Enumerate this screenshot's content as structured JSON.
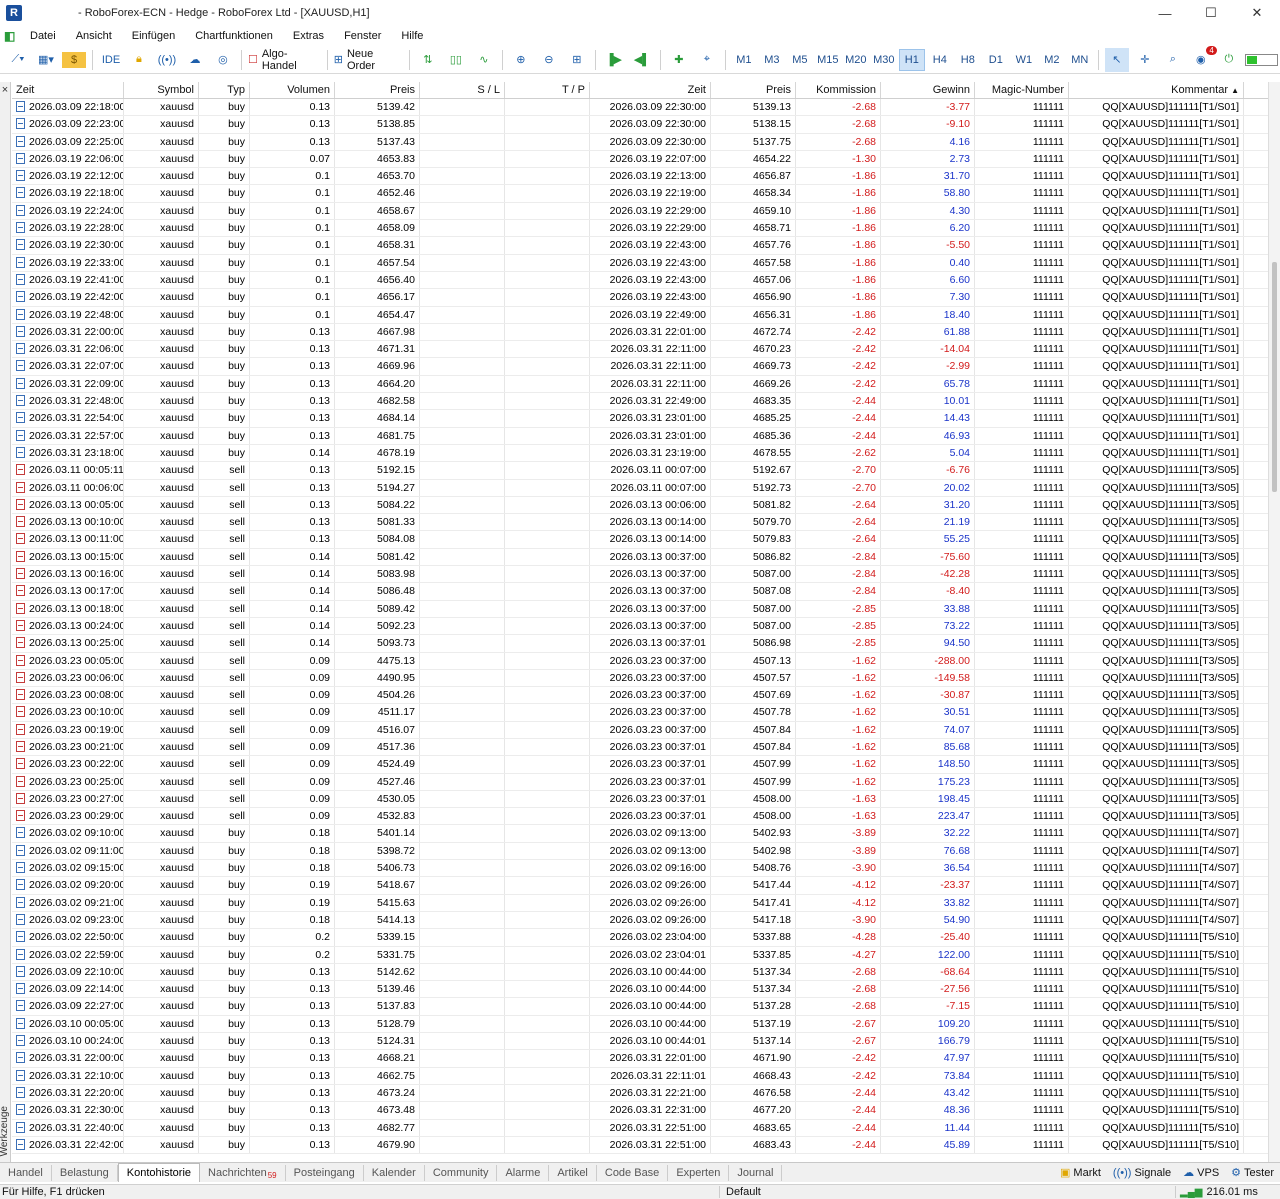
{
  "window": {
    "title": "- RoboForex-ECN - Hedge - RoboForex Ltd - [XAUUSD,H1]",
    "app_icon": "R"
  },
  "menu": [
    "Datei",
    "Ansicht",
    "Einfügen",
    "Chartfunktionen",
    "Extras",
    "Fenster",
    "Hilfe"
  ],
  "toolbar": {
    "ide_label": "IDE",
    "algo_label": "Algo-Handel",
    "order_label": "Neue Order",
    "timeframes": [
      "M1",
      "M3",
      "M5",
      "M15",
      "M20",
      "M30",
      "H1",
      "H4",
      "H8",
      "D1",
      "W1",
      "M2",
      "MN"
    ],
    "active_timeframe": "H1",
    "alert_count": "4"
  },
  "table": {
    "headers": [
      "Zeit",
      "Symbol",
      "Typ",
      "Volumen",
      "Preis",
      "S / L",
      "T / P",
      "Zeit",
      "Preis",
      "Kommission",
      "Gewinn",
      "Magic-Number",
      "Kommentar"
    ],
    "sort_arrow": "▲",
    "rows": [
      [
        "2026.03.09 22:18:00",
        "xauusd",
        "buy",
        "0.13",
        "5139.42",
        "",
        "",
        "2026.03.09 22:30:00",
        "5139.13",
        "-2.68",
        "-3.77",
        "111111",
        "QQ[XAUUSD]111111[T1/S01]"
      ],
      [
        "2026.03.09 22:23:00",
        "xauusd",
        "buy",
        "0.13",
        "5138.85",
        "",
        "",
        "2026.03.09 22:30:00",
        "5138.15",
        "-2.68",
        "-9.10",
        "111111",
        "QQ[XAUUSD]111111[T1/S01]"
      ],
      [
        "2026.03.09 22:25:00",
        "xauusd",
        "buy",
        "0.13",
        "5137.43",
        "",
        "",
        "2026.03.09 22:30:00",
        "5137.75",
        "-2.68",
        "4.16",
        "111111",
        "QQ[XAUUSD]111111[T1/S01]"
      ],
      [
        "2026.03.19 22:06:00",
        "xauusd",
        "buy",
        "0.07",
        "4653.83",
        "",
        "",
        "2026.03.19 22:07:00",
        "4654.22",
        "-1.30",
        "2.73",
        "111111",
        "QQ[XAUUSD]111111[T1/S01]"
      ],
      [
        "2026.03.19 22:12:00",
        "xauusd",
        "buy",
        "0.1",
        "4653.70",
        "",
        "",
        "2026.03.19 22:13:00",
        "4656.87",
        "-1.86",
        "31.70",
        "111111",
        "QQ[XAUUSD]111111[T1/S01]"
      ],
      [
        "2026.03.19 22:18:00",
        "xauusd",
        "buy",
        "0.1",
        "4652.46",
        "",
        "",
        "2026.03.19 22:19:00",
        "4658.34",
        "-1.86",
        "58.80",
        "111111",
        "QQ[XAUUSD]111111[T1/S01]"
      ],
      [
        "2026.03.19 22:24:00",
        "xauusd",
        "buy",
        "0.1",
        "4658.67",
        "",
        "",
        "2026.03.19 22:29:00",
        "4659.10",
        "-1.86",
        "4.30",
        "111111",
        "QQ[XAUUSD]111111[T1/S01]"
      ],
      [
        "2026.03.19 22:28:00",
        "xauusd",
        "buy",
        "0.1",
        "4658.09",
        "",
        "",
        "2026.03.19 22:29:00",
        "4658.71",
        "-1.86",
        "6.20",
        "111111",
        "QQ[XAUUSD]111111[T1/S01]"
      ],
      [
        "2026.03.19 22:30:00",
        "xauusd",
        "buy",
        "0.1",
        "4658.31",
        "",
        "",
        "2026.03.19 22:43:00",
        "4657.76",
        "-1.86",
        "-5.50",
        "111111",
        "QQ[XAUUSD]111111[T1/S01]"
      ],
      [
        "2026.03.19 22:33:00",
        "xauusd",
        "buy",
        "0.1",
        "4657.54",
        "",
        "",
        "2026.03.19 22:43:00",
        "4657.58",
        "-1.86",
        "0.40",
        "111111",
        "QQ[XAUUSD]111111[T1/S01]"
      ],
      [
        "2026.03.19 22:41:00",
        "xauusd",
        "buy",
        "0.1",
        "4656.40",
        "",
        "",
        "2026.03.19 22:43:00",
        "4657.06",
        "-1.86",
        "6.60",
        "111111",
        "QQ[XAUUSD]111111[T1/S01]"
      ],
      [
        "2026.03.19 22:42:00",
        "xauusd",
        "buy",
        "0.1",
        "4656.17",
        "",
        "",
        "2026.03.19 22:43:00",
        "4656.90",
        "-1.86",
        "7.30",
        "111111",
        "QQ[XAUUSD]111111[T1/S01]"
      ],
      [
        "2026.03.19 22:48:00",
        "xauusd",
        "buy",
        "0.1",
        "4654.47",
        "",
        "",
        "2026.03.19 22:49:00",
        "4656.31",
        "-1.86",
        "18.40",
        "111111",
        "QQ[XAUUSD]111111[T1/S01]"
      ],
      [
        "2026.03.31 22:00:00",
        "xauusd",
        "buy",
        "0.13",
        "4667.98",
        "",
        "",
        "2026.03.31 22:01:00",
        "4672.74",
        "-2.42",
        "61.88",
        "111111",
        "QQ[XAUUSD]111111[T1/S01]"
      ],
      [
        "2026.03.31 22:06:00",
        "xauusd",
        "buy",
        "0.13",
        "4671.31",
        "",
        "",
        "2026.03.31 22:11:00",
        "4670.23",
        "-2.42",
        "-14.04",
        "111111",
        "QQ[XAUUSD]111111[T1/S01]"
      ],
      [
        "2026.03.31 22:07:00",
        "xauusd",
        "buy",
        "0.13",
        "4669.96",
        "",
        "",
        "2026.03.31 22:11:00",
        "4669.73",
        "-2.42",
        "-2.99",
        "111111",
        "QQ[XAUUSD]111111[T1/S01]"
      ],
      [
        "2026.03.31 22:09:00",
        "xauusd",
        "buy",
        "0.13",
        "4664.20",
        "",
        "",
        "2026.03.31 22:11:00",
        "4669.26",
        "-2.42",
        "65.78",
        "111111",
        "QQ[XAUUSD]111111[T1/S01]"
      ],
      [
        "2026.03.31 22:48:00",
        "xauusd",
        "buy",
        "0.13",
        "4682.58",
        "",
        "",
        "2026.03.31 22:49:00",
        "4683.35",
        "-2.44",
        "10.01",
        "111111",
        "QQ[XAUUSD]111111[T1/S01]"
      ],
      [
        "2026.03.31 22:54:00",
        "xauusd",
        "buy",
        "0.13",
        "4684.14",
        "",
        "",
        "2026.03.31 23:01:00",
        "4685.25",
        "-2.44",
        "14.43",
        "111111",
        "QQ[XAUUSD]111111[T1/S01]"
      ],
      [
        "2026.03.31 22:57:00",
        "xauusd",
        "buy",
        "0.13",
        "4681.75",
        "",
        "",
        "2026.03.31 23:01:00",
        "4685.36",
        "-2.44",
        "46.93",
        "111111",
        "QQ[XAUUSD]111111[T1/S01]"
      ],
      [
        "2026.03.31 23:18:00",
        "xauusd",
        "buy",
        "0.14",
        "4678.19",
        "",
        "",
        "2026.03.31 23:19:00",
        "4678.55",
        "-2.62",
        "5.04",
        "111111",
        "QQ[XAUUSD]111111[T1/S01]"
      ],
      [
        "2026.03.11 00:05:11",
        "xauusd",
        "sell",
        "0.13",
        "5192.15",
        "",
        "",
        "2026.03.11 00:07:00",
        "5192.67",
        "-2.70",
        "-6.76",
        "111111",
        "QQ[XAUUSD]111111[T3/S05]"
      ],
      [
        "2026.03.11 00:06:00",
        "xauusd",
        "sell",
        "0.13",
        "5194.27",
        "",
        "",
        "2026.03.11 00:07:00",
        "5192.73",
        "-2.70",
        "20.02",
        "111111",
        "QQ[XAUUSD]111111[T3/S05]"
      ],
      [
        "2026.03.13 00:05:00",
        "xauusd",
        "sell",
        "0.13",
        "5084.22",
        "",
        "",
        "2026.03.13 00:06:00",
        "5081.82",
        "-2.64",
        "31.20",
        "111111",
        "QQ[XAUUSD]111111[T3/S05]"
      ],
      [
        "2026.03.13 00:10:00",
        "xauusd",
        "sell",
        "0.13",
        "5081.33",
        "",
        "",
        "2026.03.13 00:14:00",
        "5079.70",
        "-2.64",
        "21.19",
        "111111",
        "QQ[XAUUSD]111111[T3/S05]"
      ],
      [
        "2026.03.13 00:11:00",
        "xauusd",
        "sell",
        "0.13",
        "5084.08",
        "",
        "",
        "2026.03.13 00:14:00",
        "5079.83",
        "-2.64",
        "55.25",
        "111111",
        "QQ[XAUUSD]111111[T3/S05]"
      ],
      [
        "2026.03.13 00:15:00",
        "xauusd",
        "sell",
        "0.14",
        "5081.42",
        "",
        "",
        "2026.03.13 00:37:00",
        "5086.82",
        "-2.84",
        "-75.60",
        "111111",
        "QQ[XAUUSD]111111[T3/S05]"
      ],
      [
        "2026.03.13 00:16:00",
        "xauusd",
        "sell",
        "0.14",
        "5083.98",
        "",
        "",
        "2026.03.13 00:37:00",
        "5087.00",
        "-2.84",
        "-42.28",
        "111111",
        "QQ[XAUUSD]111111[T3/S05]"
      ],
      [
        "2026.03.13 00:17:00",
        "xauusd",
        "sell",
        "0.14",
        "5086.48",
        "",
        "",
        "2026.03.13 00:37:00",
        "5087.08",
        "-2.84",
        "-8.40",
        "111111",
        "QQ[XAUUSD]111111[T3/S05]"
      ],
      [
        "2026.03.13 00:18:00",
        "xauusd",
        "sell",
        "0.14",
        "5089.42",
        "",
        "",
        "2026.03.13 00:37:00",
        "5087.00",
        "-2.85",
        "33.88",
        "111111",
        "QQ[XAUUSD]111111[T3/S05]"
      ],
      [
        "2026.03.13 00:24:00",
        "xauusd",
        "sell",
        "0.14",
        "5092.23",
        "",
        "",
        "2026.03.13 00:37:00",
        "5087.00",
        "-2.85",
        "73.22",
        "111111",
        "QQ[XAUUSD]111111[T3/S05]"
      ],
      [
        "2026.03.13 00:25:00",
        "xauusd",
        "sell",
        "0.14",
        "5093.73",
        "",
        "",
        "2026.03.13 00:37:01",
        "5086.98",
        "-2.85",
        "94.50",
        "111111",
        "QQ[XAUUSD]111111[T3/S05]"
      ],
      [
        "2026.03.23 00:05:00",
        "xauusd",
        "sell",
        "0.09",
        "4475.13",
        "",
        "",
        "2026.03.23 00:37:00",
        "4507.13",
        "-1.62",
        "-288.00",
        "111111",
        "QQ[XAUUSD]111111[T3/S05]"
      ],
      [
        "2026.03.23 00:06:00",
        "xauusd",
        "sell",
        "0.09",
        "4490.95",
        "",
        "",
        "2026.03.23 00:37:00",
        "4507.57",
        "-1.62",
        "-149.58",
        "111111",
        "QQ[XAUUSD]111111[T3/S05]"
      ],
      [
        "2026.03.23 00:08:00",
        "xauusd",
        "sell",
        "0.09",
        "4504.26",
        "",
        "",
        "2026.03.23 00:37:00",
        "4507.69",
        "-1.62",
        "-30.87",
        "111111",
        "QQ[XAUUSD]111111[T3/S05]"
      ],
      [
        "2026.03.23 00:10:00",
        "xauusd",
        "sell",
        "0.09",
        "4511.17",
        "",
        "",
        "2026.03.23 00:37:00",
        "4507.78",
        "-1.62",
        "30.51",
        "111111",
        "QQ[XAUUSD]111111[T3/S05]"
      ],
      [
        "2026.03.23 00:19:00",
        "xauusd",
        "sell",
        "0.09",
        "4516.07",
        "",
        "",
        "2026.03.23 00:37:00",
        "4507.84",
        "-1.62",
        "74.07",
        "111111",
        "QQ[XAUUSD]111111[T3/S05]"
      ],
      [
        "2026.03.23 00:21:00",
        "xauusd",
        "sell",
        "0.09",
        "4517.36",
        "",
        "",
        "2026.03.23 00:37:01",
        "4507.84",
        "-1.62",
        "85.68",
        "111111",
        "QQ[XAUUSD]111111[T3/S05]"
      ],
      [
        "2026.03.23 00:22:00",
        "xauusd",
        "sell",
        "0.09",
        "4524.49",
        "",
        "",
        "2026.03.23 00:37:01",
        "4507.99",
        "-1.62",
        "148.50",
        "111111",
        "QQ[XAUUSD]111111[T3/S05]"
      ],
      [
        "2026.03.23 00:25:00",
        "xauusd",
        "sell",
        "0.09",
        "4527.46",
        "",
        "",
        "2026.03.23 00:37:01",
        "4507.99",
        "-1.62",
        "175.23",
        "111111",
        "QQ[XAUUSD]111111[T3/S05]"
      ],
      [
        "2026.03.23 00:27:00",
        "xauusd",
        "sell",
        "0.09",
        "4530.05",
        "",
        "",
        "2026.03.23 00:37:01",
        "4508.00",
        "-1.63",
        "198.45",
        "111111",
        "QQ[XAUUSD]111111[T3/S05]"
      ],
      [
        "2026.03.23 00:29:00",
        "xauusd",
        "sell",
        "0.09",
        "4532.83",
        "",
        "",
        "2026.03.23 00:37:01",
        "4508.00",
        "-1.63",
        "223.47",
        "111111",
        "QQ[XAUUSD]111111[T3/S05]"
      ],
      [
        "2026.03.02 09:10:00",
        "xauusd",
        "buy",
        "0.18",
        "5401.14",
        "",
        "",
        "2026.03.02 09:13:00",
        "5402.93",
        "-3.89",
        "32.22",
        "111111",
        "QQ[XAUUSD]111111[T4/S07]"
      ],
      [
        "2026.03.02 09:11:00",
        "xauusd",
        "buy",
        "0.18",
        "5398.72",
        "",
        "",
        "2026.03.02 09:13:00",
        "5402.98",
        "-3.89",
        "76.68",
        "111111",
        "QQ[XAUUSD]111111[T4/S07]"
      ],
      [
        "2026.03.02 09:15:00",
        "xauusd",
        "buy",
        "0.18",
        "5406.73",
        "",
        "",
        "2026.03.02 09:16:00",
        "5408.76",
        "-3.90",
        "36.54",
        "111111",
        "QQ[XAUUSD]111111[T4/S07]"
      ],
      [
        "2026.03.02 09:20:00",
        "xauusd",
        "buy",
        "0.19",
        "5418.67",
        "",
        "",
        "2026.03.02 09:26:00",
        "5417.44",
        "-4.12",
        "-23.37",
        "111111",
        "QQ[XAUUSD]111111[T4/S07]"
      ],
      [
        "2026.03.02 09:21:00",
        "xauusd",
        "buy",
        "0.19",
        "5415.63",
        "",
        "",
        "2026.03.02 09:26:00",
        "5417.41",
        "-4.12",
        "33.82",
        "111111",
        "QQ[XAUUSD]111111[T4/S07]"
      ],
      [
        "2026.03.02 09:23:00",
        "xauusd",
        "buy",
        "0.18",
        "5414.13",
        "",
        "",
        "2026.03.02 09:26:00",
        "5417.18",
        "-3.90",
        "54.90",
        "111111",
        "QQ[XAUUSD]111111[T4/S07]"
      ],
      [
        "2026.03.02 22:50:00",
        "xauusd",
        "buy",
        "0.2",
        "5339.15",
        "",
        "",
        "2026.03.02 23:04:00",
        "5337.88",
        "-4.28",
        "-25.40",
        "111111",
        "QQ[XAUUSD]111111[T5/S10]"
      ],
      [
        "2026.03.02 22:59:00",
        "xauusd",
        "buy",
        "0.2",
        "5331.75",
        "",
        "",
        "2026.03.02 23:04:01",
        "5337.85",
        "-4.27",
        "122.00",
        "111111",
        "QQ[XAUUSD]111111[T5/S10]"
      ],
      [
        "2026.03.09 22:10:00",
        "xauusd",
        "buy",
        "0.13",
        "5142.62",
        "",
        "",
        "2026.03.10 00:44:00",
        "5137.34",
        "-2.68",
        "-68.64",
        "111111",
        "QQ[XAUUSD]111111[T5/S10]"
      ],
      [
        "2026.03.09 22:14:00",
        "xauusd",
        "buy",
        "0.13",
        "5139.46",
        "",
        "",
        "2026.03.10 00:44:00",
        "5137.34",
        "-2.68",
        "-27.56",
        "111111",
        "QQ[XAUUSD]111111[T5/S10]"
      ],
      [
        "2026.03.09 22:27:00",
        "xauusd",
        "buy",
        "0.13",
        "5137.83",
        "",
        "",
        "2026.03.10 00:44:00",
        "5137.28",
        "-2.68",
        "-7.15",
        "111111",
        "QQ[XAUUSD]111111[T5/S10]"
      ],
      [
        "2026.03.10 00:05:00",
        "xauusd",
        "buy",
        "0.13",
        "5128.79",
        "",
        "",
        "2026.03.10 00:44:00",
        "5137.19",
        "-2.67",
        "109.20",
        "111111",
        "QQ[XAUUSD]111111[T5/S10]"
      ],
      [
        "2026.03.10 00:24:00",
        "xauusd",
        "buy",
        "0.13",
        "5124.31",
        "",
        "",
        "2026.03.10 00:44:01",
        "5137.14",
        "-2.67",
        "166.79",
        "111111",
        "QQ[XAUUSD]111111[T5/S10]"
      ],
      [
        "2026.03.31 22:00:00",
        "xauusd",
        "buy",
        "0.13",
        "4668.21",
        "",
        "",
        "2026.03.31 22:01:00",
        "4671.90",
        "-2.42",
        "47.97",
        "111111",
        "QQ[XAUUSD]111111[T5/S10]"
      ],
      [
        "2026.03.31 22:10:00",
        "xauusd",
        "buy",
        "0.13",
        "4662.75",
        "",
        "",
        "2026.03.31 22:11:01",
        "4668.43",
        "-2.42",
        "73.84",
        "111111",
        "QQ[XAUUSD]111111[T5/S10]"
      ],
      [
        "2026.03.31 22:20:00",
        "xauusd",
        "buy",
        "0.13",
        "4673.24",
        "",
        "",
        "2026.03.31 22:21:00",
        "4676.58",
        "-2.44",
        "43.42",
        "111111",
        "QQ[XAUUSD]111111[T5/S10]"
      ],
      [
        "2026.03.31 22:30:00",
        "xauusd",
        "buy",
        "0.13",
        "4673.48",
        "",
        "",
        "2026.03.31 22:31:00",
        "4677.20",
        "-2.44",
        "48.36",
        "111111",
        "QQ[XAUUSD]111111[T5/S10]"
      ],
      [
        "2026.03.31 22:40:00",
        "xauusd",
        "buy",
        "0.13",
        "4682.77",
        "",
        "",
        "2026.03.31 22:51:00",
        "4683.65",
        "-2.44",
        "11.44",
        "111111",
        "QQ[XAUUSD]111111[T5/S10]"
      ],
      [
        "2026.03.31 22:42:00",
        "xauusd",
        "buy",
        "0.13",
        "4679.90",
        "",
        "",
        "2026.03.31 22:51:00",
        "4683.43",
        "-2.44",
        "45.89",
        "111111",
        "QQ[XAUUSD]111111[T5/S10]"
      ]
    ]
  },
  "side_panel": {
    "close": "×",
    "label": "Werkzeuge"
  },
  "bottom_tabs": [
    {
      "label": "Handel"
    },
    {
      "label": "Belastung"
    },
    {
      "label": "Kontohistorie",
      "active": true
    },
    {
      "label": "Nachrichten",
      "badge": "59"
    },
    {
      "label": "Posteingang"
    },
    {
      "label": "Kalender"
    },
    {
      "label": "Community"
    },
    {
      "label": "Alarme"
    },
    {
      "label": "Artikel"
    },
    {
      "label": "Code Base"
    },
    {
      "label": "Experten"
    },
    {
      "label": "Journal"
    }
  ],
  "bottom_right": [
    "Markt",
    "Signale",
    "VPS",
    "Tester"
  ],
  "status": {
    "help": "Für Hilfe, F1 drücken",
    "profile": "Default",
    "ping": "216.01 ms"
  },
  "colors": {
    "negative": "#d21b1b",
    "positive": "#1a33c9",
    "active_tf": "#cfe3f7"
  }
}
